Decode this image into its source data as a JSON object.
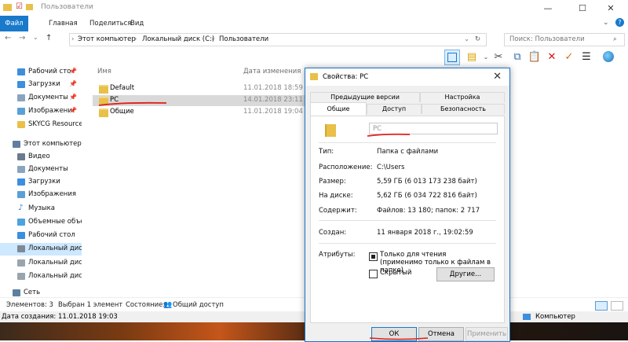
{
  "window": {
    "title": "Пользователи"
  },
  "ribbon": {
    "tabs": [
      "Файл",
      "Главная",
      "Поделиться",
      "Вид"
    ]
  },
  "address": {
    "segments": [
      "Этот компьютер",
      "Локальный диск (C:)",
      "Пользователи"
    ],
    "search_placeholder": "Поиск: Пользователи"
  },
  "nav": {
    "quick": [
      {
        "label": "Рабочий сто",
        "pinned": true
      },
      {
        "label": "Загрузки",
        "pinned": true
      },
      {
        "label": "Документы",
        "pinned": true
      },
      {
        "label": "Изображени",
        "pinned": true
      },
      {
        "label": "SKYCG Resource",
        "pinned": false
      }
    ],
    "this_pc": "Этот компьютер",
    "pc_items": [
      "Видео",
      "Документы",
      "Загрузки",
      "Изображения",
      "Музыка",
      "Объемные объе",
      "Рабочий стол",
      "Локальный дис",
      "Локальный дис",
      "Локальный дис"
    ],
    "network": "Сеть"
  },
  "filelist": {
    "columns": {
      "name": "Имя",
      "date": "Дата изменения"
    },
    "rows": [
      {
        "name": "Default",
        "date": "11.01.2018 18:59"
      },
      {
        "name": "PC",
        "date": "14.01.2018 23:11"
      },
      {
        "name": "Общие",
        "date": "11.01.2018 19:04"
      }
    ]
  },
  "status": {
    "count": "Элементов: 3",
    "selected": "Выбран 1 элемент",
    "state": "Состояние:",
    "share": "Общий доступ",
    "date_created": "Дата создания: 11.01.2018 19:03",
    "computer": "Компьютер"
  },
  "dialog": {
    "title": "Свойства: PC",
    "tabs_row1": [
      "Предыдущие версии",
      "Настройка"
    ],
    "tabs_row2": [
      "Общие",
      "Доступ",
      "Безопасность"
    ],
    "name_value": "PC",
    "props": [
      {
        "label": "Тип:",
        "value": "Папка с файлами"
      },
      {
        "label": "Расположение:",
        "value": "C:\\Users"
      },
      {
        "label": "Размер:",
        "value": "5,59 ГБ (6 013 173 238 байт)"
      },
      {
        "label": "На диске:",
        "value": "5,62 ГБ (6 034 722 816 байт)"
      },
      {
        "label": "Содержит:",
        "value": "Файлов: 13 180; папок: 2 717"
      },
      {
        "label": "Создан:",
        "value": "11 января 2018 г., 19:02:59"
      }
    ],
    "attributes_label": "Атрибуты:",
    "readonly_label": "Только для чтения",
    "readonly_sub": "(применимо только к файлам в папке)",
    "hidden_label": "Скрытый",
    "other_button": "Другие...",
    "ok": "ОК",
    "cancel": "Отмена",
    "apply": "Применить"
  },
  "colors": {
    "accent": "#1979ca",
    "annotation": "#e0201b",
    "folder": "#e8c04a"
  }
}
